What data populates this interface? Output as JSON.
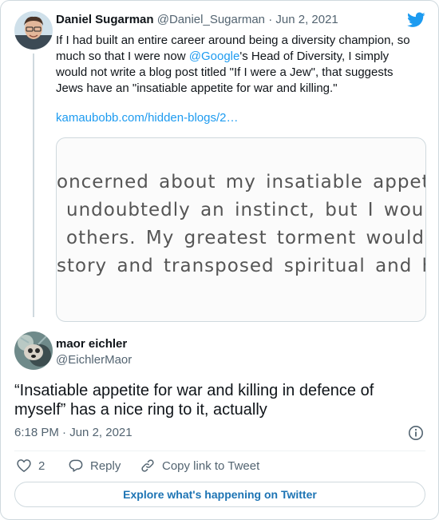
{
  "quoted_tweet": {
    "display_name": "Daniel Sugarman",
    "handle": "@Daniel_Sugarman",
    "separator": " · ",
    "date": "Jun 2, 2021",
    "text_before_mention": "If I had built an entire career around being a diversity champion, so much so that I were now ",
    "mention": "@Google",
    "text_after_mention": "'s Head of Diversity, I simply would not write a blog post titled \"If I were a Jew\", that suggests Jews have an \"insatiable appetite for war and killing.\"",
    "link": "kamaubobb.com/hidden-blogs/2…",
    "media_lines": [
      "oncerned about my insatiable appetite fo",
      "undoubtedly an instinct, but I would",
      "others.  My greatest torment would be",
      "story and transposed spiritual and hu"
    ]
  },
  "reply_tweet": {
    "display_name": "maor eichler",
    "handle": "@EichlerMaor",
    "text": "“Insatiable appetite for war and killing in defence of myself” has a nice ring to it, actually",
    "time": "6:18 PM",
    "separator": " · ",
    "date": "Jun 2, 2021"
  },
  "actions": {
    "like_count": "2",
    "reply_label": "Reply",
    "copy_label": "Copy link to Tweet"
  },
  "explore_label": "Explore what's happening on Twitter",
  "colors": {
    "accent": "#1d9bf0",
    "muted": "#536471",
    "border": "#cfd9de"
  },
  "icons": [
    "twitter-bird-icon",
    "info-icon",
    "heart-icon",
    "reply-bubble-icon",
    "link-icon"
  ]
}
